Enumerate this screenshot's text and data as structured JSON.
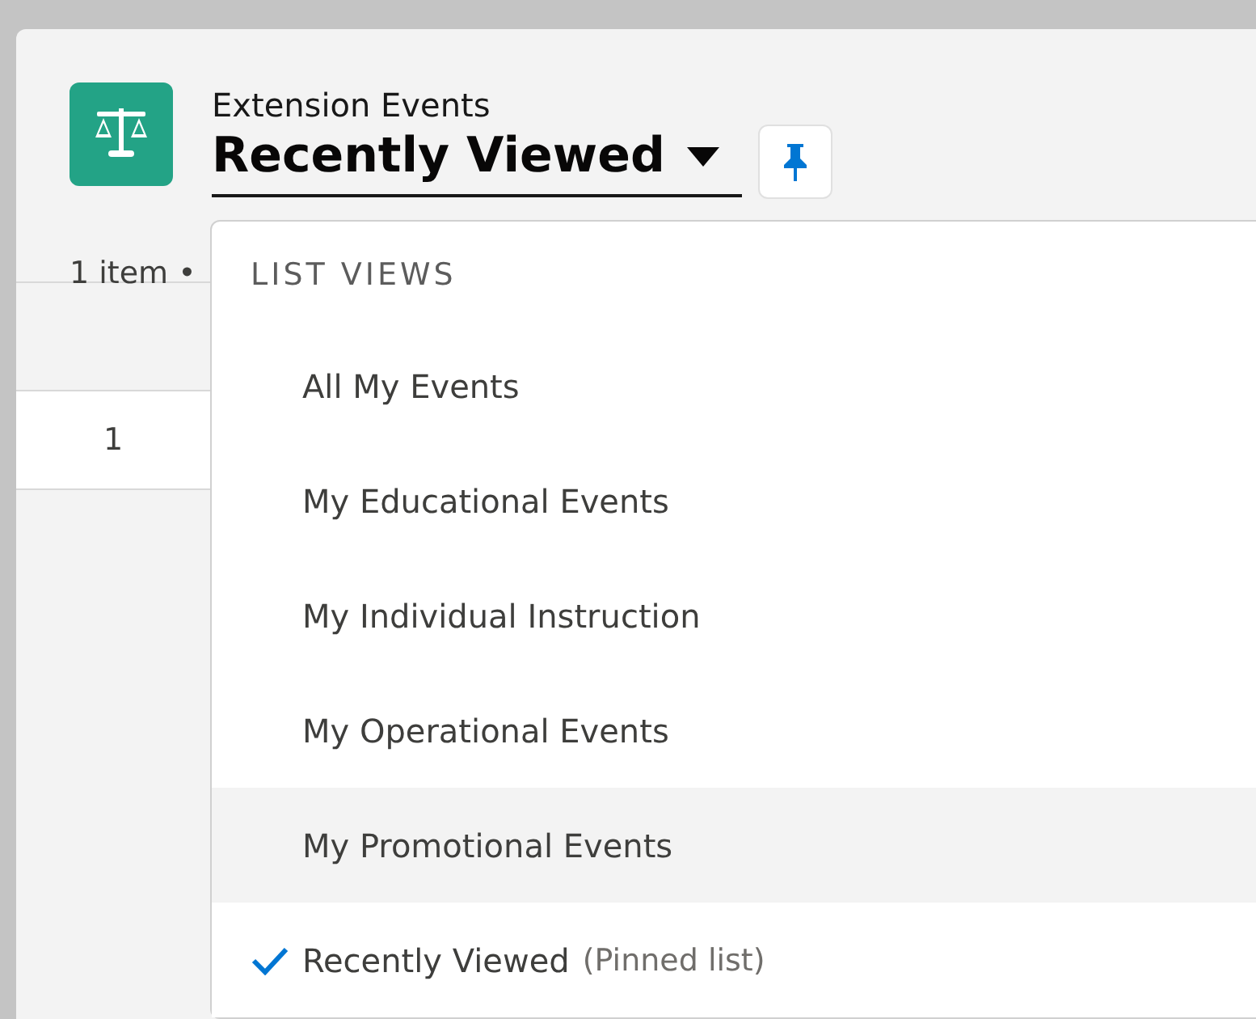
{
  "header": {
    "object_label": "Extension Events",
    "list_title": "Recently Viewed",
    "menu_open": true
  },
  "summary": "1 item •",
  "table": {
    "rows": [
      {
        "row_number": "1"
      }
    ]
  },
  "list_views": {
    "heading": "LIST VIEWS",
    "items": [
      {
        "label": "All My Events",
        "highlighted": false,
        "checked": false
      },
      {
        "label": "My Educational Events",
        "highlighted": false,
        "checked": false
      },
      {
        "label": "My Individual Instruction",
        "highlighted": false,
        "checked": false
      },
      {
        "label": "My Operational Events",
        "highlighted": false,
        "checked": false
      },
      {
        "label": "My Promotional Events",
        "highlighted": true,
        "checked": false
      },
      {
        "label": "Recently Viewed",
        "note": "(Pinned list)",
        "highlighted": false,
        "checked": true
      }
    ]
  }
}
